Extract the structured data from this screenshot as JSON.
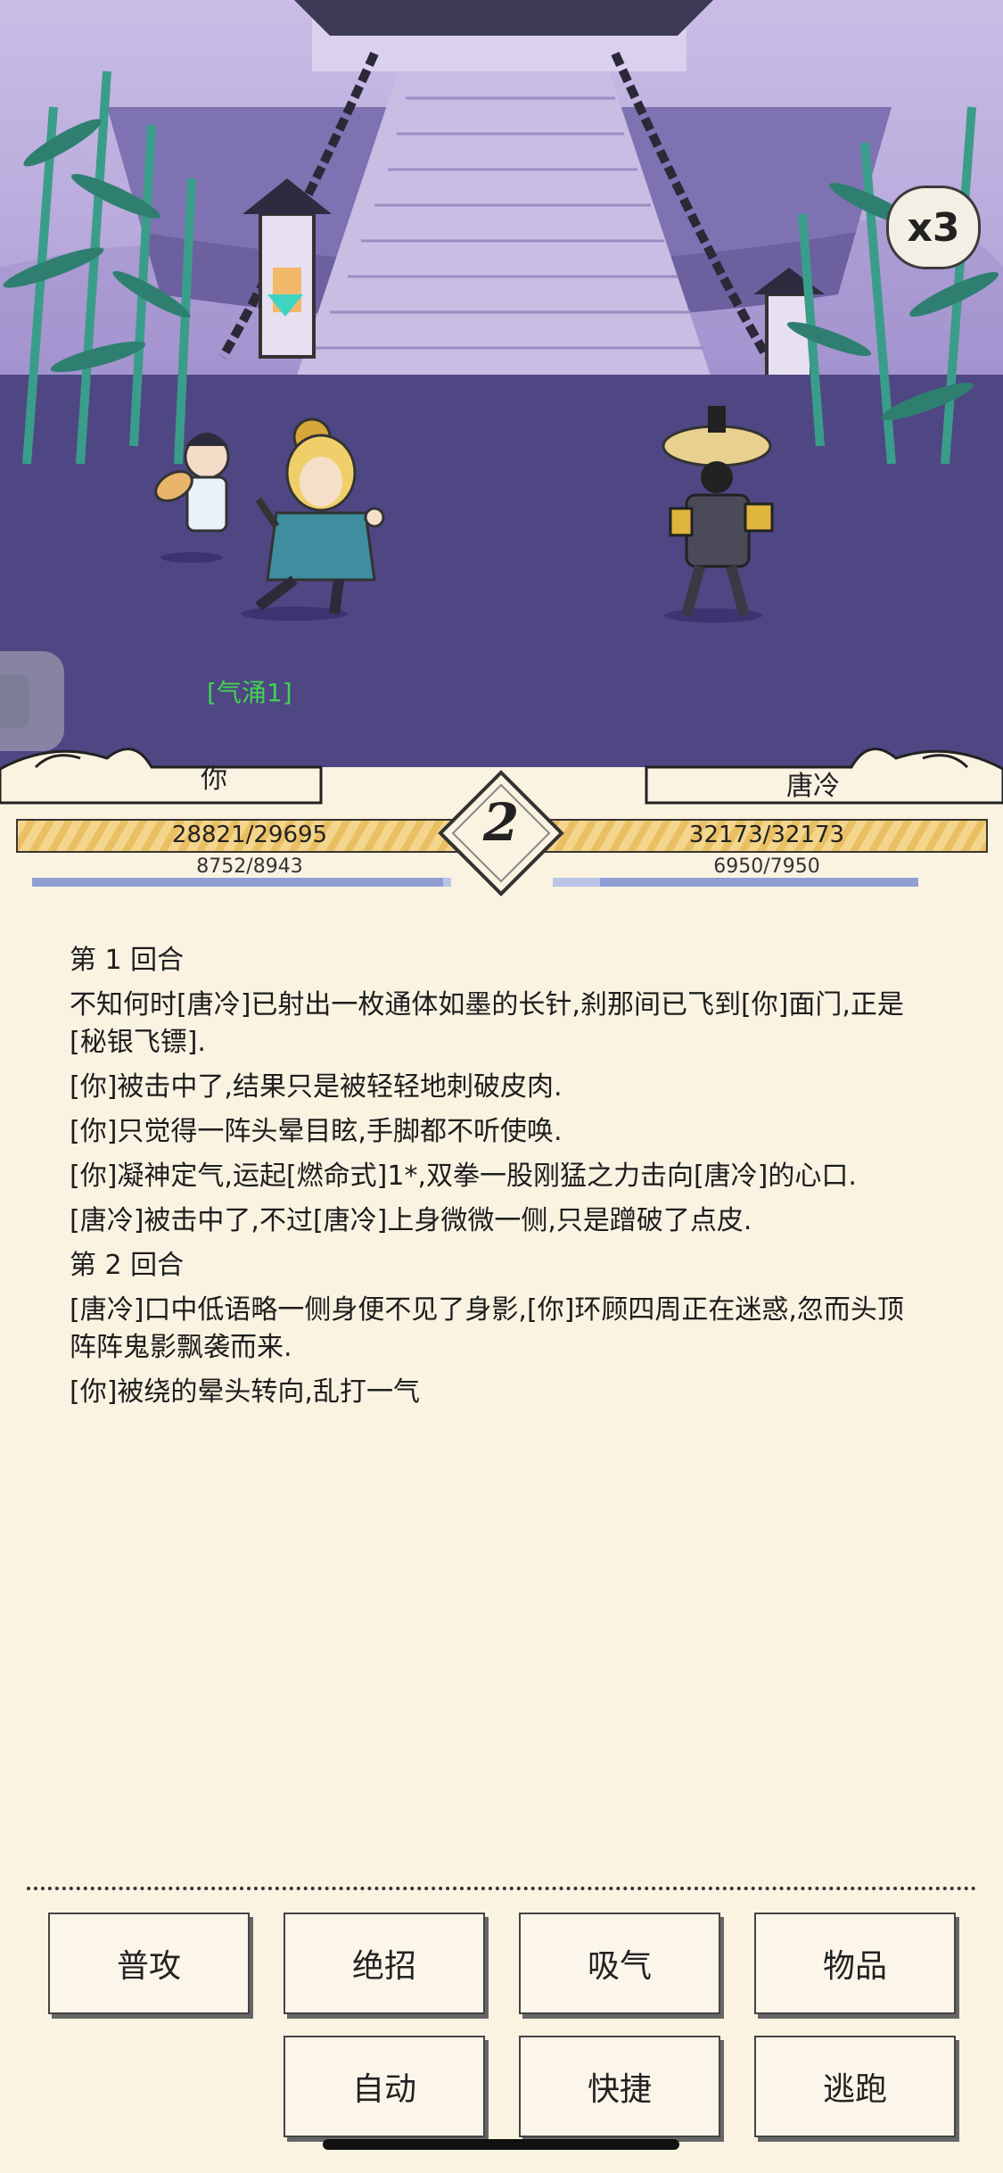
{
  "scene": {
    "speed_label": "x3",
    "buff_label": "[气涌1]"
  },
  "player": {
    "name": "你",
    "hp_text": "28821/29695",
    "hp_fraction": 0.97,
    "mp_text": "8752/8943",
    "mp_fraction": 0.98
  },
  "enemy": {
    "name": "唐冷",
    "hp_text": "32173/32173",
    "hp_fraction": 1.0,
    "mp_text": "6950/7950",
    "mp_fraction": 0.87
  },
  "round_number": "2",
  "log": [
    "第 1 回合",
    "不知何时[唐冷]已射出一枚通体如墨的长针,刹那间已飞到[你]面门,正是[秘银飞镖].",
    "[你]被击中了,结果只是被轻轻地刺破皮肉.",
    "[你]只觉得一阵头晕目眩,手脚都不听使唤.",
    "[你]凝神定气,运起[燃命式]1*,双拳一股刚猛之力击向[唐冷]的心口.",
    "[唐冷]被击中了,不过[唐冷]上身微微一侧,只是蹭破了点皮.",
    "第 2 回合",
    "[唐冷]口中低语略一侧身便不见了身影,[你]环顾四周正在迷惑,忽而头顶阵阵鬼影飘袭而来.",
    "[你]被绕的晕头转向,乱打一气"
  ],
  "actions": {
    "attack": "普攻",
    "ultimate": "绝招",
    "breathe": "吸气",
    "items": "物品",
    "auto": "自动",
    "shortcut": "快捷",
    "flee": "逃跑"
  },
  "colors": {
    "hp_fill": "#f0cf82",
    "mp_fill": "#8f9fd6",
    "buff_text": "#43d253",
    "paper": "#fbf3e2"
  }
}
